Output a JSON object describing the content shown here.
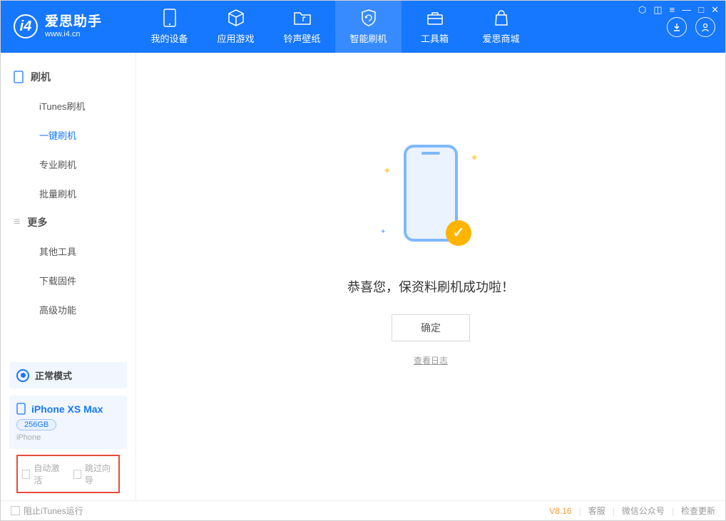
{
  "header": {
    "app_name": "爱思助手",
    "app_url": "www.i4.cn",
    "tabs": [
      {
        "label": "我的设备"
      },
      {
        "label": "应用游戏"
      },
      {
        "label": "铃声壁纸"
      },
      {
        "label": "智能刷机"
      },
      {
        "label": "工具箱"
      },
      {
        "label": "爱思商城"
      }
    ]
  },
  "sidebar": {
    "group1_title": "刷机",
    "items1": [
      {
        "label": "iTunes刷机"
      },
      {
        "label": "一键刷机"
      },
      {
        "label": "专业刷机"
      },
      {
        "label": "批量刷机"
      }
    ],
    "group2_title": "更多",
    "items2": [
      {
        "label": "其他工具"
      },
      {
        "label": "下载固件"
      },
      {
        "label": "高级功能"
      }
    ],
    "mode": "正常模式",
    "device_name": "iPhone XS Max",
    "device_storage": "256GB",
    "device_type": "iPhone",
    "opt1": "自动激活",
    "opt2": "跳过向导"
  },
  "main": {
    "success": "恭喜您，保资料刷机成功啦！",
    "ok": "确定",
    "log": "查看日志"
  },
  "footer": {
    "block_itunes": "阻止iTunes运行",
    "version": "V8.16",
    "link1": "客服",
    "link2": "微信公众号",
    "link3": "检查更新"
  }
}
